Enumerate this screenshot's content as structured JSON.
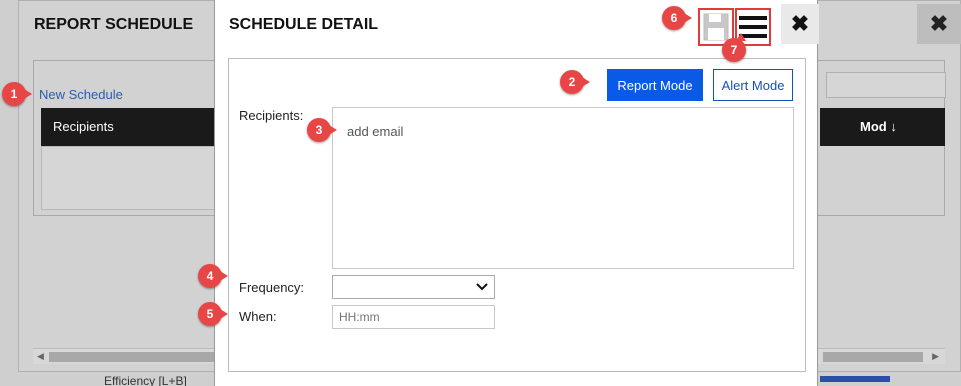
{
  "background": {
    "title": "REPORT SCHEDULE",
    "new_schedule_link": "New Schedule",
    "col_recipients": "Recipients",
    "col_mod": "Mod ↓",
    "footer_text": "Efficiency [L+B]",
    "close_symbol": "✖"
  },
  "modal": {
    "title": "SCHEDULE DETAIL",
    "close_symbol": "✖",
    "report_mode_label": "Report Mode",
    "alert_mode_label": "Alert Mode",
    "recipients_label": "Recipients:",
    "recipients_placeholder": "add email",
    "frequency_label": "Frequency:",
    "frequency_value": "",
    "when_label": "When:",
    "when_placeholder": "HH:mm"
  },
  "callouts": [
    "1",
    "2",
    "3",
    "4",
    "5",
    "6",
    "7"
  ],
  "colors": {
    "accent_blue": "#0a5ae8",
    "callout_red": "#e84646",
    "header_dark": "#1a1a1a"
  }
}
